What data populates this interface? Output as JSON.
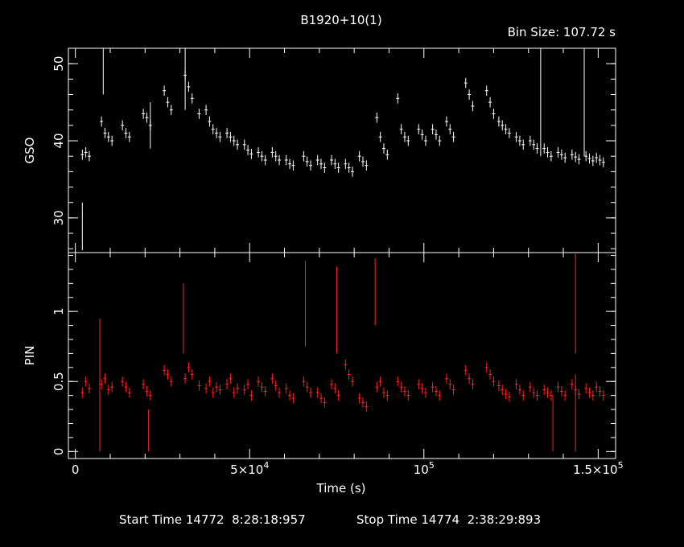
{
  "title": "B1920+10(1)",
  "bin_size_label": "Bin Size: 107.72 s",
  "footer": {
    "start_label": "Start Time 14772  8:28:18:957",
    "stop_label": "Stop Time 14774  2:38:29:893"
  },
  "colors": {
    "background": "#000000",
    "gso": "#ffffff",
    "pin": "#ff2020",
    "axes": "#ffffff"
  },
  "chart_data": [
    {
      "type": "scatter",
      "ylabel": "GSO",
      "xlim": [
        -2000,
        155000
      ],
      "ylim": [
        25.5,
        52
      ],
      "y_ticks": [
        30,
        40,
        50
      ],
      "y_tick_labels": [
        "30",
        "40",
        "50"
      ],
      "series": [
        {
          "color": "#ffffff",
          "points": [
            [
              2000,
              38.2
            ],
            [
              3000,
              38.5
            ],
            [
              4000,
              38.0
            ],
            [
              7500,
              42.5
            ],
            [
              8500,
              41.0
            ],
            [
              9500,
              40.5
            ],
            [
              10500,
              40.0
            ],
            [
              13500,
              42.0
            ],
            [
              14500,
              41.0
            ],
            [
              15500,
              40.5
            ],
            [
              19500,
              43.5
            ],
            [
              20500,
              43.0
            ],
            [
              21500,
              42.0
            ],
            [
              25500,
              46.5
            ],
            [
              26500,
              45.0
            ],
            [
              27500,
              44.0
            ],
            [
              31500,
              48.5
            ],
            [
              32500,
              47.0
            ],
            [
              33500,
              45.5
            ],
            [
              35500,
              43.5
            ],
            [
              37500,
              44.0
            ],
            [
              38500,
              42.5
            ],
            [
              39500,
              41.5
            ],
            [
              40500,
              41.0
            ],
            [
              41500,
              40.5
            ],
            [
              43500,
              41.0
            ],
            [
              44500,
              40.5
            ],
            [
              45500,
              40.0
            ],
            [
              46500,
              39.5
            ],
            [
              48500,
              39.5
            ],
            [
              49500,
              38.8
            ],
            [
              50500,
              38.3
            ],
            [
              52500,
              38.5
            ],
            [
              53500,
              38.0
            ],
            [
              54500,
              37.5
            ],
            [
              56500,
              38.5
            ],
            [
              57500,
              38.0
            ],
            [
              58500,
              37.5
            ],
            [
              60500,
              37.5
            ],
            [
              61500,
              37.0
            ],
            [
              62500,
              36.8
            ],
            [
              65500,
              38.0
            ],
            [
              66500,
              37.3
            ],
            [
              67500,
              36.8
            ],
            [
              69500,
              37.5
            ],
            [
              70500,
              37.0
            ],
            [
              71500,
              36.5
            ],
            [
              73500,
              37.5
            ],
            [
              74500,
              37.0
            ],
            [
              75500,
              36.5
            ],
            [
              77500,
              37.0
            ],
            [
              78500,
              36.5
            ],
            [
              79500,
              36.0
            ],
            [
              81500,
              38.0
            ],
            [
              82500,
              37.3
            ],
            [
              83500,
              36.8
            ],
            [
              86500,
              43.0
            ],
            [
              87500,
              40.5
            ],
            [
              88500,
              39.0
            ],
            [
              89500,
              38.2
            ],
            [
              92500,
              45.5
            ],
            [
              93500,
              41.5
            ],
            [
              94500,
              40.5
            ],
            [
              95500,
              40.0
            ],
            [
              98500,
              41.5
            ],
            [
              99500,
              40.8
            ],
            [
              100500,
              40.0
            ],
            [
              102500,
              41.5
            ],
            [
              103500,
              40.8
            ],
            [
              104500,
              40.0
            ],
            [
              106500,
              42.5
            ],
            [
              107500,
              41.5
            ],
            [
              108500,
              40.5
            ],
            [
              112000,
              47.5
            ],
            [
              113000,
              46.0
            ],
            [
              114000,
              44.5
            ],
            [
              118000,
              46.5
            ],
            [
              119000,
              45.0
            ],
            [
              120000,
              43.5
            ],
            [
              121500,
              42.5
            ],
            [
              122500,
              42.0
            ],
            [
              123500,
              41.5
            ],
            [
              124500,
              41.0
            ],
            [
              126500,
              40.5
            ],
            [
              127500,
              40.0
            ],
            [
              128500,
              39.5
            ],
            [
              130500,
              40.0
            ],
            [
              131500,
              39.5
            ],
            [
              132500,
              39.0
            ],
            [
              134500,
              39.0
            ],
            [
              135500,
              38.5
            ],
            [
              136500,
              38.0
            ],
            [
              138500,
              38.5
            ],
            [
              139500,
              38.2
            ],
            [
              140500,
              37.8
            ],
            [
              142500,
              38.2
            ],
            [
              143500,
              37.9
            ],
            [
              144500,
              37.6
            ],
            [
              146500,
              38.0
            ],
            [
              147500,
              37.7
            ],
            [
              148500,
              37.4
            ],
            [
              149500,
              37.8
            ],
            [
              150500,
              37.5
            ],
            [
              151500,
              37.2
            ]
          ],
          "spikes": [
            [
              2000,
              25.8,
              32
            ],
            [
              8000,
              46,
              52
            ],
            [
              21500,
              39,
              45
            ],
            [
              31500,
              44,
              52
            ],
            [
              133500,
              38,
              52
            ],
            [
              146000,
              38,
              52
            ]
          ]
        }
      ]
    },
    {
      "type": "scatter",
      "xlabel": "Time (s)",
      "ylabel": "PIN",
      "xlim": [
        -2000,
        155000
      ],
      "ylim": [
        -0.05,
        1.42
      ],
      "x_ticks": [
        0,
        50000,
        100000,
        150000
      ],
      "x_tick_labels": [
        {
          "base": "0",
          "exp": ""
        },
        {
          "base": "5×10",
          "exp": "4"
        },
        {
          "base": "10",
          "exp": "5"
        },
        {
          "base": "1.5×10",
          "exp": "5"
        }
      ],
      "y_ticks": [
        0,
        0.5,
        1
      ],
      "y_tick_labels": [
        "0",
        "0.5",
        "1"
      ],
      "series": [
        {
          "color": "#ff2020",
          "points": [
            [
              2000,
              0.42
            ],
            [
              3000,
              0.5
            ],
            [
              4000,
              0.45
            ],
            [
              7500,
              0.48
            ],
            [
              8500,
              0.52
            ],
            [
              9500,
              0.44
            ],
            [
              10500,
              0.46
            ],
            [
              13500,
              0.5
            ],
            [
              14500,
              0.46
            ],
            [
              15500,
              0.42
            ],
            [
              19500,
              0.48
            ],
            [
              20500,
              0.43
            ],
            [
              21500,
              0.4
            ],
            [
              25500,
              0.58
            ],
            [
              26500,
              0.55
            ],
            [
              27500,
              0.5
            ],
            [
              31500,
              0.52
            ],
            [
              32500,
              0.6
            ],
            [
              33500,
              0.55
            ],
            [
              35500,
              0.47
            ],
            [
              37500,
              0.45
            ],
            [
              38500,
              0.5
            ],
            [
              39500,
              0.42
            ],
            [
              40500,
              0.46
            ],
            [
              41500,
              0.44
            ],
            [
              43500,
              0.48
            ],
            [
              44500,
              0.52
            ],
            [
              45500,
              0.42
            ],
            [
              46500,
              0.45
            ],
            [
              48500,
              0.44
            ],
            [
              49500,
              0.48
            ],
            [
              50500,
              0.4
            ],
            [
              52500,
              0.5
            ],
            [
              53500,
              0.46
            ],
            [
              54500,
              0.43
            ],
            [
              56500,
              0.52
            ],
            [
              57500,
              0.47
            ],
            [
              58500,
              0.42
            ],
            [
              60500,
              0.45
            ],
            [
              61500,
              0.4
            ],
            [
              62500,
              0.38
            ],
            [
              65500,
              0.5
            ],
            [
              66500,
              0.46
            ],
            [
              67500,
              0.42
            ],
            [
              69500,
              0.42
            ],
            [
              70500,
              0.38
            ],
            [
              71500,
              0.35
            ],
            [
              73500,
              0.48
            ],
            [
              74500,
              0.45
            ],
            [
              75500,
              0.4
            ],
            [
              77500,
              0.62
            ],
            [
              78500,
              0.55
            ],
            [
              79500,
              0.5
            ],
            [
              81500,
              0.38
            ],
            [
              82500,
              0.35
            ],
            [
              83500,
              0.32
            ],
            [
              86500,
              0.46
            ],
            [
              87500,
              0.5
            ],
            [
              88500,
              0.42
            ],
            [
              89500,
              0.4
            ],
            [
              92500,
              0.5
            ],
            [
              93500,
              0.46
            ],
            [
              94500,
              0.43
            ],
            [
              95500,
              0.4
            ],
            [
              98500,
              0.48
            ],
            [
              99500,
              0.45
            ],
            [
              100500,
              0.42
            ],
            [
              102500,
              0.46
            ],
            [
              103500,
              0.43
            ],
            [
              104500,
              0.4
            ],
            [
              106500,
              0.52
            ],
            [
              107500,
              0.48
            ],
            [
              108500,
              0.44
            ],
            [
              112000,
              0.58
            ],
            [
              113000,
              0.52
            ],
            [
              114000,
              0.48
            ],
            [
              118000,
              0.6
            ],
            [
              119000,
              0.55
            ],
            [
              120000,
              0.5
            ],
            [
              121500,
              0.47
            ],
            [
              122500,
              0.44
            ],
            [
              123500,
              0.41
            ],
            [
              124500,
              0.39
            ],
            [
              126500,
              0.48
            ],
            [
              127500,
              0.44
            ],
            [
              128500,
              0.4
            ],
            [
              130500,
              0.46
            ],
            [
              131500,
              0.42
            ],
            [
              132500,
              0.4
            ],
            [
              134500,
              0.44
            ],
            [
              135500,
              0.42
            ],
            [
              136500,
              0.4
            ],
            [
              138500,
              0.46
            ],
            [
              139500,
              0.43
            ],
            [
              140500,
              0.4
            ],
            [
              142500,
              0.48
            ],
            [
              143500,
              0.44
            ],
            [
              144500,
              0.41
            ],
            [
              146500,
              0.45
            ],
            [
              147500,
              0.42
            ],
            [
              148500,
              0.4
            ],
            [
              149500,
              0.46
            ],
            [
              150500,
              0.43
            ],
            [
              151500,
              0.4
            ]
          ],
          "spikes": [
            [
              7000,
              0,
              0.95
            ],
            [
              21000,
              0,
              0.3
            ],
            [
              31000,
              0.7,
              1.2
            ],
            [
              66000,
              0.75,
              1.36
            ],
            [
              75000,
              0.7,
              1.32
            ],
            [
              86000,
              0.9,
              1.38
            ],
            [
              137000,
              0,
              0.4
            ],
            [
              143500,
              0.7,
              1.42
            ],
            [
              143500,
              0,
              0.55
            ]
          ]
        }
      ]
    }
  ]
}
